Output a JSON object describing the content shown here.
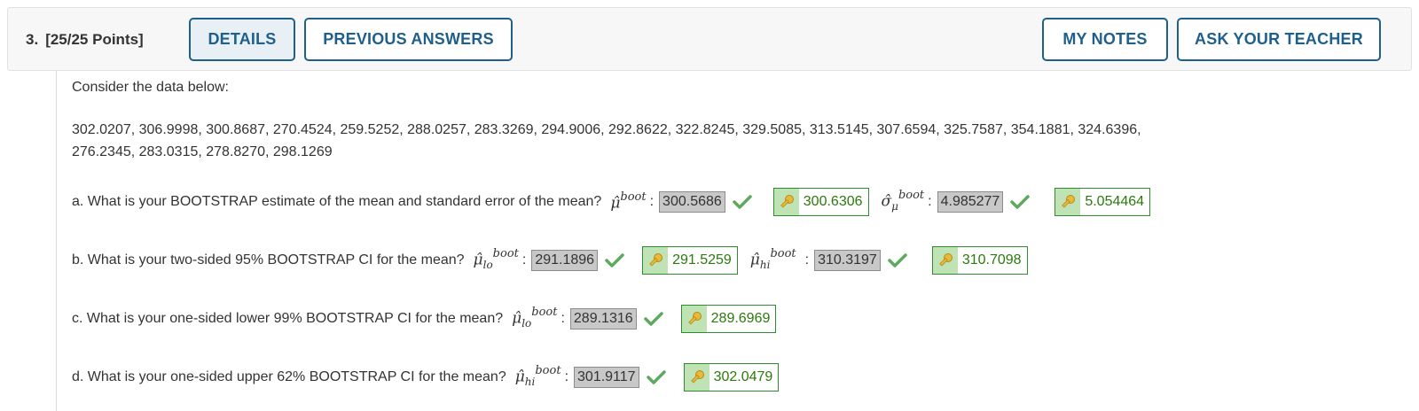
{
  "header": {
    "question_number": "3.",
    "points": "[25/25 Points]",
    "buttons": {
      "details": "DETAILS",
      "previous_answers": "PREVIOUS ANSWERS",
      "my_notes": "MY NOTES",
      "ask_teacher": "ASK YOUR TEACHER"
    }
  },
  "content": {
    "intro": "Consider the data below:",
    "data_line1": "302.0207, 306.9998, 300.8687, 270.4524, 259.5252, 288.0257, 283.3269, 294.9006, 292.8622, 322.8245, 329.5085, 313.5145, 307.6594, 325.7587, 354.1881, 324.6396,",
    "data_line2": "276.2345, 283.0315, 278.8270, 298.1269",
    "parts": {
      "a": {
        "prompt": "a. What is your BOOTSTRAP estimate of the mean and standard error of the mean?",
        "mu_symbol": "μ̂",
        "mu_sup": "boot",
        "mu_answer": "300.5686",
        "mu_key": "300.6306",
        "sigma_symbol": "σ̂",
        "sigma_sub": "μ",
        "sigma_sup": "boot",
        "sigma_answer": "4.985277",
        "sigma_key": "5.054464"
      },
      "b": {
        "prompt": "b. What is your two-sided 95% BOOTSTRAP CI for the mean?",
        "lo_symbol": "μ̂",
        "lo_sub": "lo",
        "lo_sup": "boot",
        "lo_answer": "291.1896",
        "lo_key": "291.5259",
        "hi_symbol": "μ̂",
        "hi_sub": "hi",
        "hi_sup": "boot",
        "hi_answer": "310.3197",
        "hi_key": "310.7098"
      },
      "c": {
        "prompt": "c. What is your one-sided lower 99% BOOTSTRAP CI for the mean?",
        "symbol": "μ̂",
        "sub": "lo",
        "sup": "boot",
        "answer": "289.1316",
        "key": "289.6969"
      },
      "d": {
        "prompt": "d. What is your one-sided upper 62% BOOTSTRAP CI for the mean?",
        "symbol": "μ̂",
        "sub": "hi",
        "sup": "boot",
        "answer": "301.9117",
        "key": "302.0479"
      }
    }
  },
  "colors": {
    "button_border": "#1f5f8b",
    "correct_green": "#2b7a0b",
    "answer_bg": "#c8c8c8"
  },
  "icons": [
    "check-icon",
    "key-icon"
  ]
}
